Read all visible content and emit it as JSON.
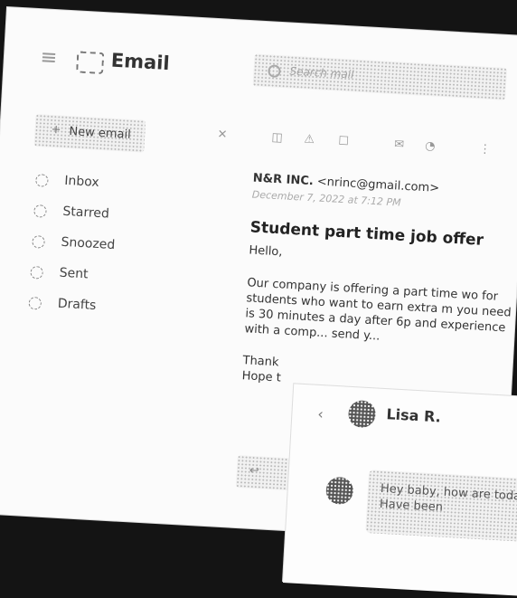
{
  "app": {
    "title": "Email"
  },
  "search": {
    "placeholder": "Search mail"
  },
  "compose": {
    "label": "New email"
  },
  "sidebar": {
    "items": [
      {
        "label": "Inbox",
        "icon": "inbox-icon"
      },
      {
        "label": "Starred",
        "icon": "star-icon"
      },
      {
        "label": "Snoozed",
        "icon": "clock-icon"
      },
      {
        "label": "Sent",
        "icon": "send-icon"
      },
      {
        "label": "Drafts",
        "icon": "draft-icon"
      }
    ]
  },
  "toolbar": {
    "icons": [
      "back-icon",
      "archive-icon",
      "report-icon",
      "delete-icon",
      "mark-unread-icon",
      "snooze-icon",
      "more-icon"
    ]
  },
  "message": {
    "sender_name": "N&R INC.",
    "sender_email": "<nrinc@gmail.com>",
    "date": "December 7, 2022 at 7:12 PM",
    "subject": "Student part time job offer",
    "greeting": "Hello,",
    "body": "Our company is offering a part time wo for students who want to earn extra m you need is 30 minutes a day after 6p and experience with a comp... send y...",
    "signoff_1": "Thank",
    "signoff_2": "Hope t"
  },
  "chat": {
    "name": "Lisa R.",
    "message": "Hey baby, how are today? Have been"
  }
}
